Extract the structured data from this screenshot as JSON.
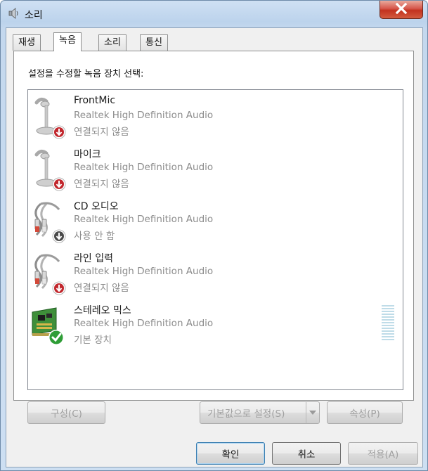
{
  "window": {
    "title": "소리"
  },
  "tabs": [
    {
      "label": "재생"
    },
    {
      "label": "녹음"
    },
    {
      "label": "소리"
    },
    {
      "label": "통신"
    }
  ],
  "active_tab": "녹음",
  "instruction": "설정을 수정할 녹음 장치 선택:",
  "devices": [
    {
      "name": "FrontMic",
      "description": "Realtek High Definition Audio",
      "state": "연결되지 않음",
      "icon": "microphone-icon",
      "badge": "disconnected-red-arrow"
    },
    {
      "name": "마이크",
      "description": "Realtek High Definition Audio",
      "state": "연결되지 않음",
      "icon": "microphone-icon",
      "badge": "disconnected-red-arrow"
    },
    {
      "name": "CD 오디오",
      "description": "Realtek High Definition Audio",
      "state": "사용 안 함",
      "icon": "rca-cable-icon",
      "badge": "disabled-gray-arrow"
    },
    {
      "name": "라인 입력",
      "description": "Realtek High Definition Audio",
      "state": "연결되지 않음",
      "icon": "rca-cable-icon",
      "badge": "disconnected-red-arrow"
    },
    {
      "name": "스테레오 믹스",
      "description": "Realtek High Definition Audio",
      "state": "기본 장치",
      "icon": "sound-card-icon",
      "badge": "default-green-check"
    }
  ],
  "buttons": {
    "configure": "구성(C)",
    "set_default": "기본값으로 설정(S)",
    "properties": "속성(P)",
    "ok": "확인",
    "cancel": "취소",
    "apply": "적용(A)"
  },
  "colors": {
    "titlebar": "#c4d8ee",
    "close_button": "#c2321f",
    "disconnected_badge": "#c1272d",
    "default_badge": "#2e9d36",
    "disabled_text": "#8c8c8c"
  }
}
